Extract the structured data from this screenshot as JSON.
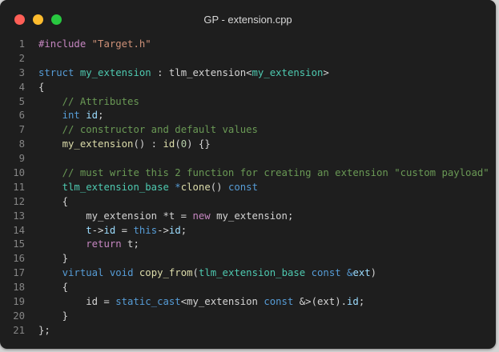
{
  "window": {
    "title": "GP - extension.cpp",
    "controls": [
      {
        "name": "close-button",
        "color": "#ff5f57"
      },
      {
        "name": "minimize-button",
        "color": "#febc2e"
      },
      {
        "name": "maximize-button",
        "color": "#28c840"
      }
    ]
  },
  "colors": {
    "background": "#1e1e1e",
    "line_number": "#858585",
    "plain": "#d4d4d4",
    "keyword": "#569cd6",
    "preprocessor": "#c586c0",
    "string": "#ce9178",
    "comment": "#6a9955",
    "type": "#4ec9b0",
    "function": "#dcdcaa",
    "variable": "#9cdcfe",
    "number": "#b5cea8"
  },
  "lines": [
    {
      "n": "1",
      "tokens": [
        [
          "#include",
          "preprocessor"
        ],
        [
          " ",
          "plain"
        ],
        [
          "\"Target.h\"",
          "string"
        ]
      ]
    },
    {
      "n": "2",
      "tokens": []
    },
    {
      "n": "3",
      "tokens": [
        [
          "struct",
          "keyword"
        ],
        [
          " ",
          "plain"
        ],
        [
          "my_extension",
          "type"
        ],
        [
          " : tlm_extension<",
          "plain"
        ],
        [
          "my_extension",
          "type"
        ],
        [
          ">",
          "plain"
        ]
      ]
    },
    {
      "n": "4",
      "tokens": [
        [
          "{",
          "plain"
        ]
      ]
    },
    {
      "n": "5",
      "tokens": [
        [
          "    ",
          "plain"
        ],
        [
          "// Attributes",
          "comment"
        ]
      ]
    },
    {
      "n": "6",
      "tokens": [
        [
          "    ",
          "plain"
        ],
        [
          "int",
          "keyword"
        ],
        [
          " ",
          "plain"
        ],
        [
          "id",
          "variable"
        ],
        [
          ";",
          "plain"
        ]
      ]
    },
    {
      "n": "7",
      "tokens": [
        [
          "    ",
          "plain"
        ],
        [
          "// constructor and default values",
          "comment"
        ]
      ]
    },
    {
      "n": "8",
      "tokens": [
        [
          "    ",
          "plain"
        ],
        [
          "my_extension",
          "function"
        ],
        [
          "() : ",
          "plain"
        ],
        [
          "id",
          "function"
        ],
        [
          "(",
          "plain"
        ],
        [
          "0",
          "number"
        ],
        [
          ") {}",
          "plain"
        ]
      ]
    },
    {
      "n": "9",
      "tokens": []
    },
    {
      "n": "10",
      "tokens": [
        [
          "    ",
          "plain"
        ],
        [
          "// must write this 2 function for creating an extension \"custom payload\"",
          "comment"
        ]
      ]
    },
    {
      "n": "11",
      "tokens": [
        [
          "    ",
          "plain"
        ],
        [
          "tlm_extension_base",
          "type"
        ],
        [
          " ",
          "plain"
        ],
        [
          "*",
          "keyword"
        ],
        [
          "clone",
          "function"
        ],
        [
          "() ",
          "plain"
        ],
        [
          "const",
          "keyword"
        ]
      ]
    },
    {
      "n": "12",
      "tokens": [
        [
          "    {",
          "plain"
        ]
      ]
    },
    {
      "n": "13",
      "tokens": [
        [
          "        my_extension *t = ",
          "plain"
        ],
        [
          "new",
          "preprocessor"
        ],
        [
          " my_extension;",
          "plain"
        ]
      ]
    },
    {
      "n": "14",
      "tokens": [
        [
          "        ",
          "plain"
        ],
        [
          "t",
          "variable"
        ],
        [
          "->",
          "plain"
        ],
        [
          "id",
          "variable"
        ],
        [
          " = ",
          "plain"
        ],
        [
          "this",
          "keyword"
        ],
        [
          "->",
          "plain"
        ],
        [
          "id",
          "variable"
        ],
        [
          ";",
          "plain"
        ]
      ]
    },
    {
      "n": "15",
      "tokens": [
        [
          "        ",
          "plain"
        ],
        [
          "return",
          "preprocessor"
        ],
        [
          " t;",
          "plain"
        ]
      ]
    },
    {
      "n": "16",
      "tokens": [
        [
          "    }",
          "plain"
        ]
      ]
    },
    {
      "n": "17",
      "tokens": [
        [
          "    ",
          "plain"
        ],
        [
          "virtual",
          "keyword"
        ],
        [
          " ",
          "plain"
        ],
        [
          "void",
          "keyword"
        ],
        [
          " ",
          "plain"
        ],
        [
          "copy_from",
          "function"
        ],
        [
          "(",
          "plain"
        ],
        [
          "tlm_extension_base",
          "type"
        ],
        [
          " ",
          "plain"
        ],
        [
          "const",
          "keyword"
        ],
        [
          " ",
          "plain"
        ],
        [
          "&",
          "keyword"
        ],
        [
          "ext",
          "variable"
        ],
        [
          ")",
          "plain"
        ]
      ]
    },
    {
      "n": "18",
      "tokens": [
        [
          "    {",
          "plain"
        ]
      ]
    },
    {
      "n": "19",
      "tokens": [
        [
          "        id = ",
          "plain"
        ],
        [
          "static_cast",
          "keyword"
        ],
        [
          "<my_extension ",
          "plain"
        ],
        [
          "const",
          "keyword"
        ],
        [
          " &>(ext).",
          "plain"
        ],
        [
          "id",
          "variable"
        ],
        [
          ";",
          "plain"
        ]
      ]
    },
    {
      "n": "20",
      "tokens": [
        [
          "    }",
          "plain"
        ]
      ]
    },
    {
      "n": "21",
      "tokens": [
        [
          "};",
          "plain"
        ]
      ]
    }
  ]
}
